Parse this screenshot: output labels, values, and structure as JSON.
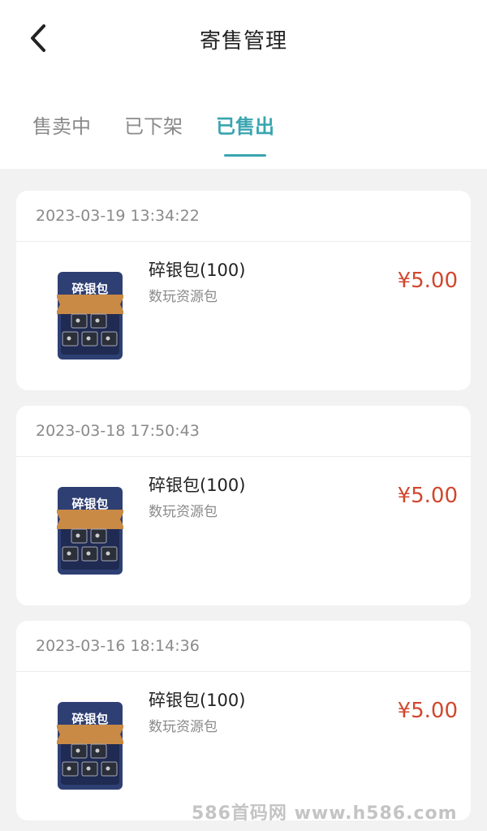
{
  "header": {
    "title": "寄售管理",
    "back_icon": "chevron-left-icon"
  },
  "tabs": [
    {
      "label": "售卖中",
      "active": false
    },
    {
      "label": "已下架",
      "active": false
    },
    {
      "label": "已售出",
      "active": true
    }
  ],
  "colors": {
    "accent": "#3aa5b0",
    "price": "#d2472e"
  },
  "orders": [
    {
      "date": "2023-03-19 13:34:22",
      "name": "碎银包(100)",
      "subtitle": "数玩资源包",
      "price": "¥5.00",
      "thumb_label": "碎银包"
    },
    {
      "date": "2023-03-18 17:50:43",
      "name": "碎银包(100)",
      "subtitle": "数玩资源包",
      "price": "¥5.00",
      "thumb_label": "碎银包"
    },
    {
      "date": "2023-03-16 18:14:36",
      "name": "碎银包(100)",
      "subtitle": "数玩资源包",
      "price": "¥5.00",
      "thumb_label": "碎银包"
    }
  ],
  "watermark": "586首码网 www.h586.com"
}
